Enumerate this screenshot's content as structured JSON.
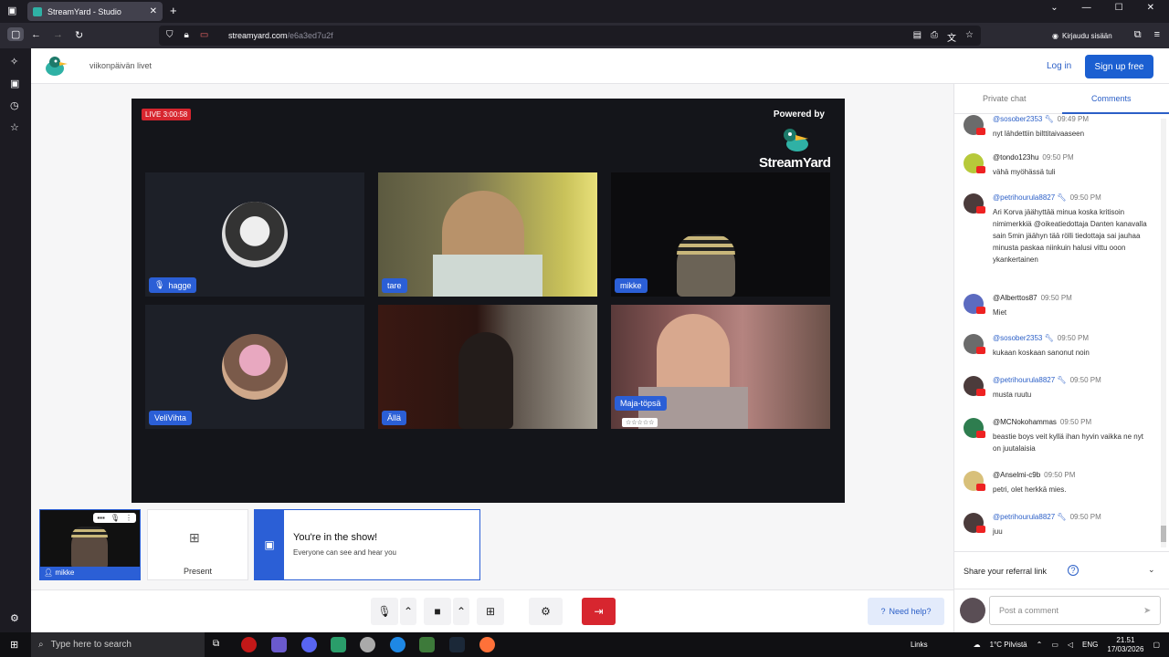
{
  "browser": {
    "tab_title": "StreamYard - Studio",
    "url_domain": "streamyard.com",
    "url_path": "/e6a3ed7u2f",
    "signin_label": "Kirjaudu sisään"
  },
  "header": {
    "studio_title": "viikonpäivän livet",
    "login_label": "Log in",
    "signup_label": "Sign up free"
  },
  "stage": {
    "live_label": "LIVE 3:00:58",
    "powered_by": "Powered by",
    "brand": "StreamYard",
    "participants": [
      {
        "name": "hagge"
      },
      {
        "name": "tare"
      },
      {
        "name": "mikke"
      },
      {
        "name": "VeliVihta"
      },
      {
        "name": "Ällä"
      },
      {
        "name": "Maja-töpsä"
      }
    ],
    "stars": "☆☆☆☆☆"
  },
  "bottom": {
    "self_name": "mikke",
    "present_label": "Present",
    "inshow_title": "You're in the show!",
    "inshow_sub": "Everyone can see and hear you",
    "help_label": "Need help?"
  },
  "chat": {
    "tab_private": "Private chat",
    "tab_comments": "Comments",
    "comments": [
      {
        "name": "@sosober2353",
        "time": "09:49 PM",
        "mod": true,
        "text": "nyt lähdettiin bilttitaivaaseen",
        "color": "#6b6b6b"
      },
      {
        "name": "@tondo123hu",
        "time": "09:50 PM",
        "mod": false,
        "text": "vähä myöhässä tuli",
        "color": "#b7c93a"
      },
      {
        "name": "@petrihourula8827",
        "time": "09:50 PM",
        "mod": true,
        "text": "Ari Korva jäähyttää minua koska kritisoin nimimerkkiä @oikeatiedottaja Danten kanavalla sain 5min jäähyn tää rölli tiedottaja sai jauhaa minusta paskaa niinkuin halusi vittu ooon ykankertainen",
        "color": "#4b3b3b"
      },
      {
        "name": "@Alberttos87",
        "time": "09:50 PM",
        "mod": false,
        "text": "Miet",
        "color": "#5c6bc0"
      },
      {
        "name": "@sosober2353",
        "time": "09:50 PM",
        "mod": true,
        "text": "kukaan koskaan sanonut noin",
        "color": "#6b6b6b"
      },
      {
        "name": "@petrihourula8827",
        "time": "09:50 PM",
        "mod": true,
        "text": "musta ruutu",
        "color": "#4b3b3b"
      },
      {
        "name": "@MCNokohammas",
        "time": "09:50 PM",
        "mod": false,
        "text": "beastie boys veit kyllä ihan hyvin vaikka ne nyt on juutalaisia",
        "color": "#2e7d4f"
      },
      {
        "name": "@Anselmi-c9b",
        "time": "09:50 PM",
        "mod": false,
        "text": "petri, olet herkkä mies.",
        "color": "#d8c07a"
      },
      {
        "name": "@petrihourula8827",
        "time": "09:50 PM",
        "mod": true,
        "text": "juu",
        "color": "#4b3b3b"
      }
    ],
    "referral_label": "Share your referral link",
    "composer_placeholder": "Post a comment"
  },
  "taskbar": {
    "search_placeholder": "Type here to search",
    "links_label": "Links",
    "weather": "1°C Pilvistä",
    "lang": "ENG",
    "time": "21.51",
    "date": "17/03/2026"
  },
  "colors": {
    "accent": "#2b5fd6",
    "live": "#d7262f",
    "stage_bg": "#14151a"
  }
}
